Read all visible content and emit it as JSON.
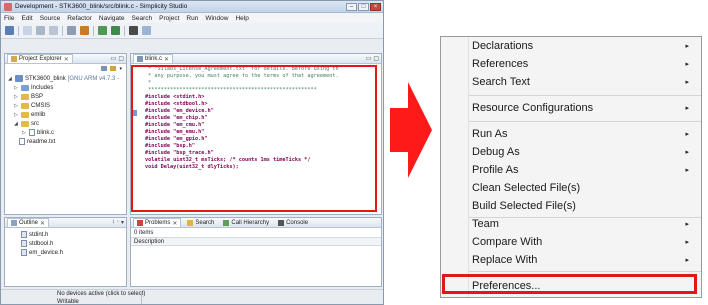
{
  "ide": {
    "title": "Development - STK3600_blink/src/blink.c - Simplicity Studio",
    "menu": [
      "File",
      "Edit",
      "Source",
      "Refactor",
      "Navigate",
      "Search",
      "Project",
      "Run",
      "Window",
      "Help"
    ],
    "project_explorer": {
      "tab_label": "Project Explorer",
      "project_name": "STK3600_blink",
      "project_tag": "[GNU ARM v4.7.3 -",
      "items": [
        "Includes",
        "BSP",
        "CMSIS",
        "emlib",
        "src",
        "blink.c",
        "readme.txt"
      ]
    },
    "editor": {
      "tab_label": "blink.c",
      "lines": [
        " * \"Silabs_License_Agreement.txt\" for details. Before using th",
        " * any purpose, you must agree to the terms of that agreement.",
        " *",
        " ******************************************************",
        "",
        "#include <stdint.h>",
        "#include <stdbool.h>",
        "#include \"em_device.h\"",
        "#include \"em_chip.h\"",
        "#include \"em_cmu.h\"",
        "#include \"em_emu.h\"",
        "#include \"em_gpio.h\"",
        "#include \"bsp.h\"",
        "#include \"bsp_trace.h\"",
        "",
        "volatile uint32_t msTicks; /* counts 1ms timeTicks */",
        "",
        "void Delay(uint32_t dlyTicks);"
      ]
    },
    "outline": {
      "tab_label": "Outline",
      "items": [
        "stdint.h",
        "stdbool.h",
        "em_device.h"
      ]
    },
    "bottom_tabs": {
      "problems": "Problems",
      "search": "Search",
      "call_hierarchy": "Call Hierarchy",
      "console": "Console",
      "count": "0 items",
      "column": "Description"
    },
    "status": {
      "device": "No devices active (click to select)",
      "mode": "Writable"
    }
  },
  "context_menu": {
    "items": [
      {
        "label": "Declarations",
        "submenu": true
      },
      {
        "label": "References",
        "submenu": true
      },
      {
        "label": "Search Text",
        "submenu": true
      },
      {
        "label": "Resource Configurations",
        "submenu": true
      },
      {
        "label": "Run As",
        "submenu": true
      },
      {
        "label": "Debug As",
        "submenu": true
      },
      {
        "label": "Profile As",
        "submenu": true
      },
      {
        "label": "Clean Selected File(s)",
        "submenu": false
      },
      {
        "label": "Build Selected File(s)",
        "submenu": false
      },
      {
        "label": "Team",
        "submenu": true
      },
      {
        "label": "Compare With",
        "submenu": true
      },
      {
        "label": "Replace With",
        "submenu": true
      },
      {
        "label": "Preferences...",
        "submenu": false
      }
    ],
    "submenu_glyph": "▸"
  },
  "colors": {
    "highlight": "#e01818",
    "arrow": "#ff1a1a"
  }
}
